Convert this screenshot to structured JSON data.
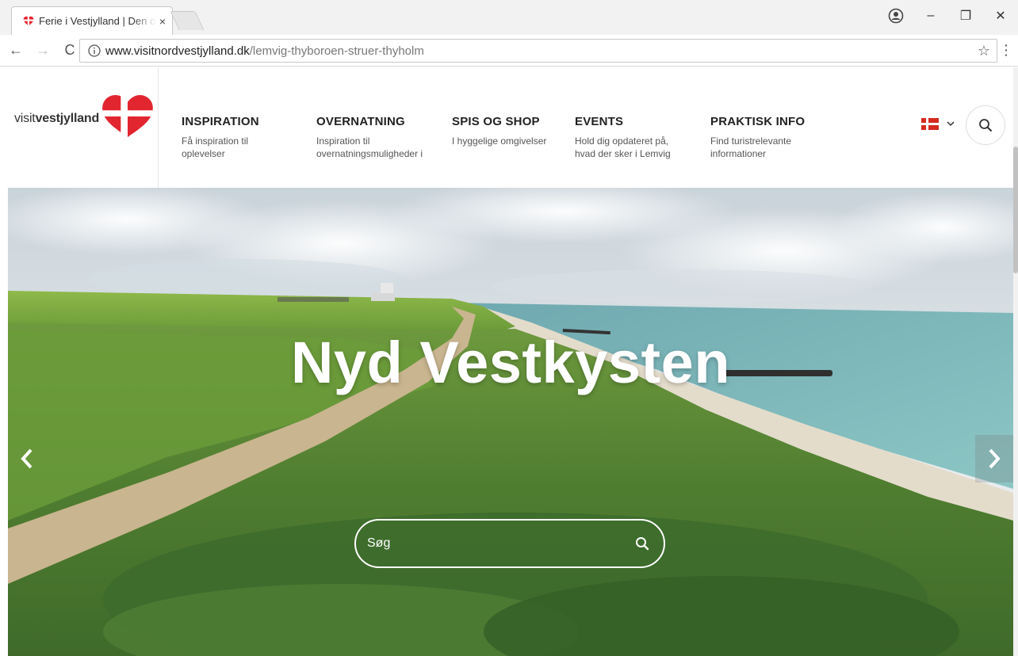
{
  "browser": {
    "tab_title": "Ferie i Vestjylland | Den o",
    "tab_close": "×",
    "url_host": "www.visitnordvestjylland.dk",
    "url_path": "/lemvig-thyboroen-struer-thyholm",
    "back": "←",
    "forward": "→",
    "reload": "C",
    "minimize": "–",
    "maximize": "❐",
    "close": "✕",
    "star": "☆",
    "menu": "⋮"
  },
  "header": {
    "logo_prefix": "visit",
    "logo_bold": "vestjylland",
    "nav": [
      {
        "title": "INSPIRATION",
        "desc": "Få inspiration til oplevelser"
      },
      {
        "title": "OVERNATNING",
        "desc": "Inspiration til overnatningsmuligheder i"
      },
      {
        "title": "SPIS OG SHOP",
        "desc": "I hyggelige omgivelser"
      },
      {
        "title": "EVENTS",
        "desc": "Hold dig opdateret på, hvad der sker i Lemvig"
      },
      {
        "title": "PRAKTISK INFO",
        "desc": "Find turistrelevante informationer"
      }
    ],
    "lang_chevron": "⌄"
  },
  "hero": {
    "title": "Nyd Vestkysten",
    "search_placeholder": "Søg"
  },
  "colors": {
    "brand_red": "#e2262f",
    "text_dark": "#222222",
    "sea": "#7fb9bb",
    "grass": "#5f9237"
  }
}
